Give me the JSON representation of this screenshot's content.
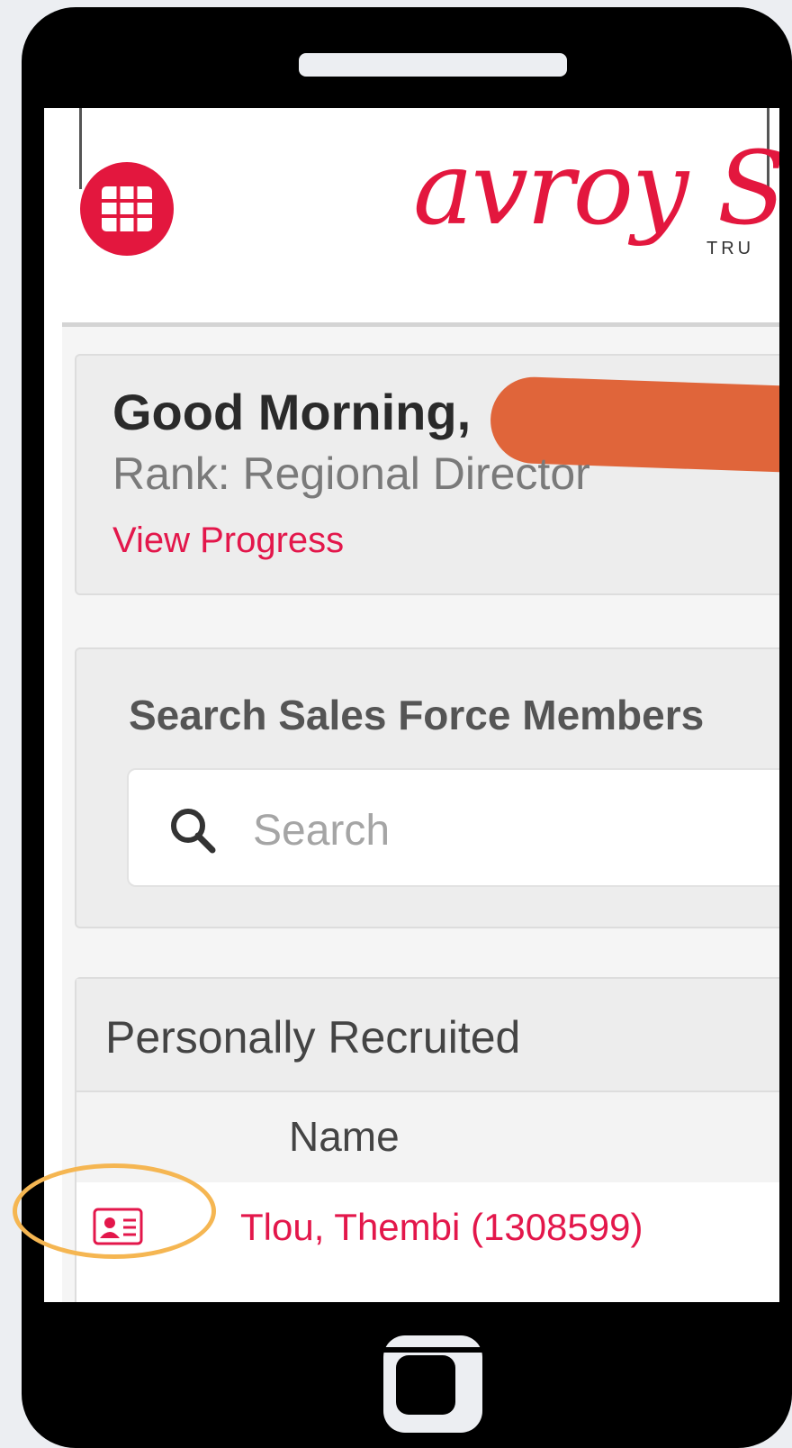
{
  "header": {
    "logo_text": "avroy S",
    "logo_sub": "TRU"
  },
  "greeting_card": {
    "greeting": "Good Morning,",
    "rank": "Rank: Regional Director",
    "view_progress": "View Progress"
  },
  "search": {
    "title": "Search Sales Force Members",
    "placeholder": "Search"
  },
  "recruits": {
    "title": "Personally Recruited",
    "columns": [
      "Name"
    ],
    "rows": [
      {
        "name": "Tlou, Thembi (1308599)"
      }
    ]
  },
  "colors": {
    "accent": "#e3173e",
    "highlight": "#f5b652",
    "redaction": "#e0653a"
  },
  "icons": {
    "menu": "grid-icon",
    "search": "search-icon",
    "contact": "contact-card-icon"
  }
}
